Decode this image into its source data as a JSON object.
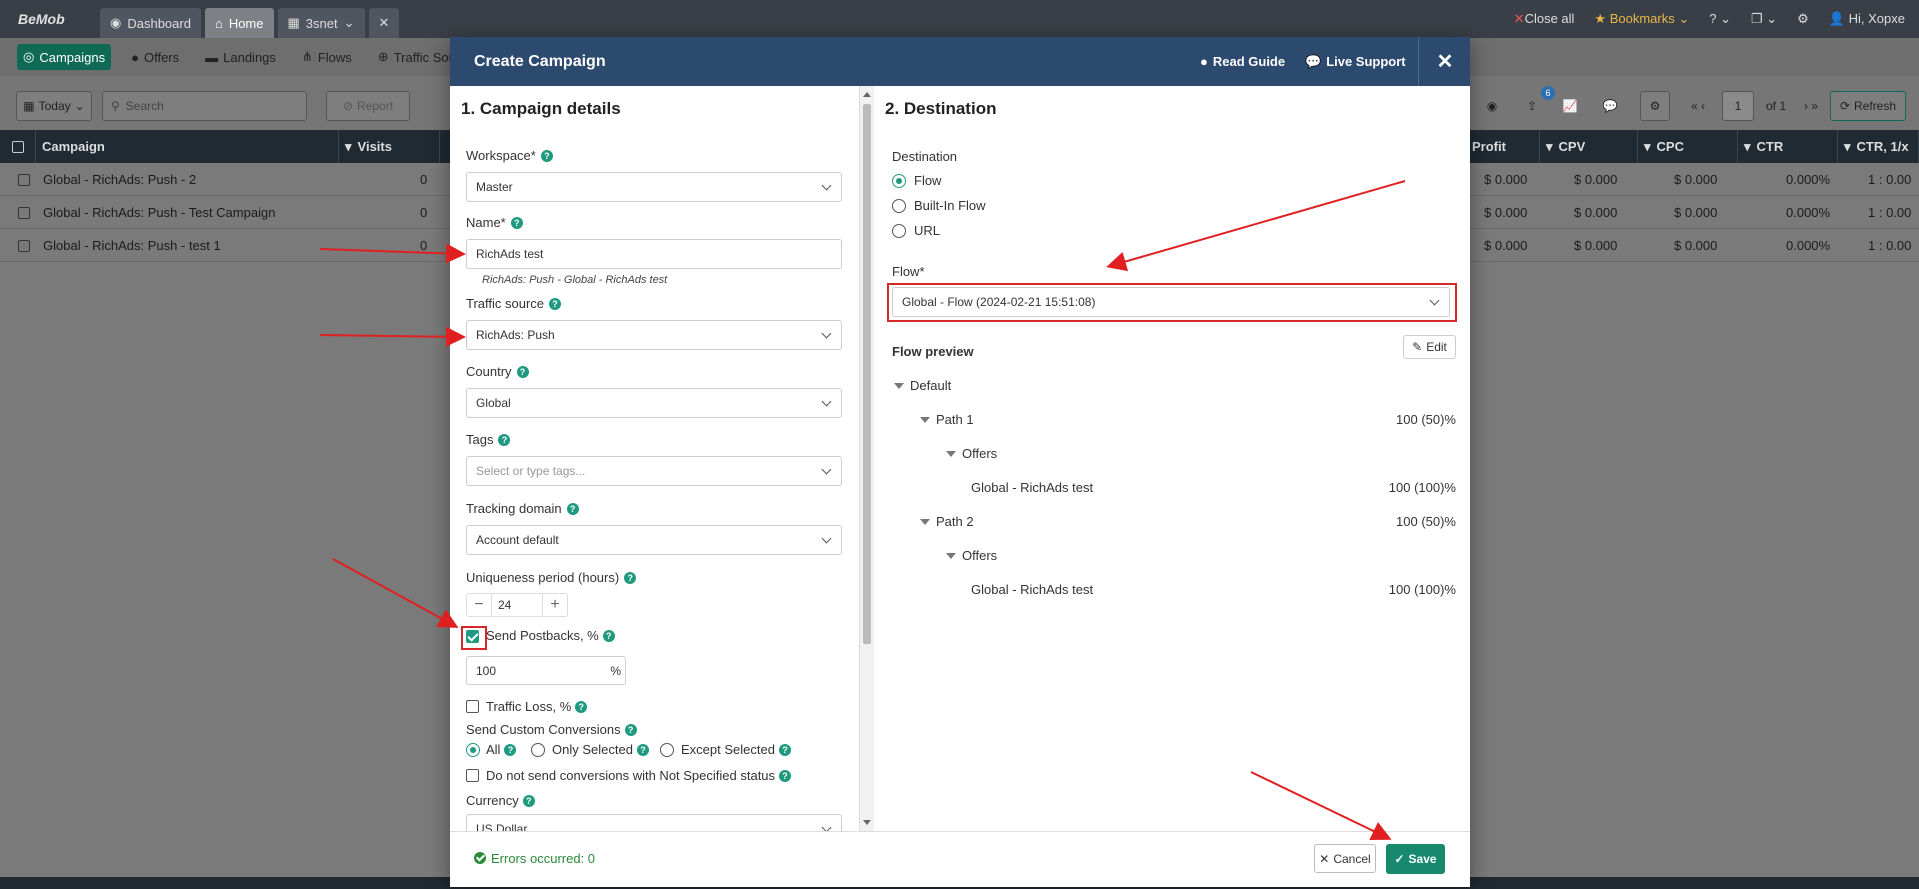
{
  "app": {
    "logo": "BeMob",
    "tabs": [
      {
        "label": "Dashboard",
        "icon": "gauge-icon"
      },
      {
        "label": "Home",
        "icon": "home-icon"
      },
      {
        "label": "3snet",
        "icon": "table-icon"
      }
    ],
    "top_right": {
      "close_all": "Close all",
      "bookmarks": "Bookmarks",
      "user": "Hi, Xopxe"
    }
  },
  "nav": {
    "items": [
      "Campaigns",
      "Offers",
      "Landings",
      "Flows",
      "Traffic Sources"
    ]
  },
  "toolbar": {
    "date": "Today",
    "search_placeholder": "Search",
    "report": "Report",
    "page": "1",
    "of_pages": "of 1",
    "refresh": "Refresh",
    "badge": "6"
  },
  "grid": {
    "columns_left": [
      "Campaign",
      "Visits"
    ],
    "columns_right": [
      "Profit",
      "CPV",
      "CPC",
      "CTR",
      "CTR, 1/x"
    ],
    "rows": [
      {
        "name": "Global - RichAds: Push - 2",
        "visits": "0",
        "profit": "$ 0.000",
        "cpv": "$ 0.000",
        "cpc": "$ 0.000",
        "ctr": "0.000%",
        "ctr1x": "1 : 0.00"
      },
      {
        "name": "Global - RichAds: Push - Test Campaign",
        "visits": "0",
        "profit": "$ 0.000",
        "cpv": "$ 0.000",
        "cpc": "$ 0.000",
        "ctr": "0.000%",
        "ctr1x": "1 : 0.00"
      },
      {
        "name": "Global - RichAds: Push - test 1",
        "visits": "0",
        "profit": "$ 0.000",
        "cpv": "$ 0.000",
        "cpc": "$ 0.000",
        "ctr": "0.000%",
        "ctr1x": "1 : 0.00"
      }
    ]
  },
  "modal": {
    "title": "Create Campaign",
    "read_guide": "Read Guide",
    "live_support": "Live Support",
    "left": {
      "section": "1. Campaign details",
      "workspace_label": "Workspace*",
      "workspace_value": "Master",
      "name_label": "Name*",
      "name_value": "RichAds test",
      "name_hint": "RichAds: Push - Global - RichAds test",
      "traffic_label": "Traffic source",
      "traffic_value": "RichAds: Push",
      "country_label": "Country",
      "country_value": "Global",
      "tags_label": "Tags",
      "tags_placeholder": "Select or type tags...",
      "domain_label": "Tracking domain",
      "domain_value": "Account default",
      "uniq_label": "Uniqueness period (hours)",
      "uniq_value": "24",
      "postbacks_label": "Send Postbacks, %",
      "postbacks_value": "100",
      "pct_unit": "%",
      "traffic_loss_label": "Traffic Loss, %",
      "custom_conv_label": "Send Custom Conversions",
      "conv_all": "All",
      "conv_only": "Only Selected",
      "conv_except": "Except Selected",
      "not_specified": "Do not send conversions with Not Specified status",
      "currency_label": "Currency",
      "currency_value": "US Dollar"
    },
    "right": {
      "section": "2. Destination",
      "dest_label": "Destination",
      "dest_options": [
        "Flow",
        "Built-In Flow",
        "URL"
      ],
      "flow_label": "Flow*",
      "flow_value": "Global - Flow (2024-02-21 15:51:08)",
      "preview_label": "Flow preview",
      "edit": "Edit",
      "tree": {
        "default": "Default",
        "path1": "Path 1",
        "path1_pct": "100 (50)%",
        "offers": "Offers",
        "offer1": "Global - RichAds test",
        "offer1_pct": "100 (100)%",
        "path2": "Path 2",
        "path2_pct": "100 (50)%",
        "offer2": "Global - RichAds test",
        "offer2_pct": "100 (100)%"
      }
    },
    "footer": {
      "errors": "Errors occurred: 0",
      "cancel": "Cancel",
      "save": "Save"
    }
  },
  "colors": {
    "accent": "#17896e",
    "header": "#2c4a6e",
    "annotation": "#d62828"
  }
}
